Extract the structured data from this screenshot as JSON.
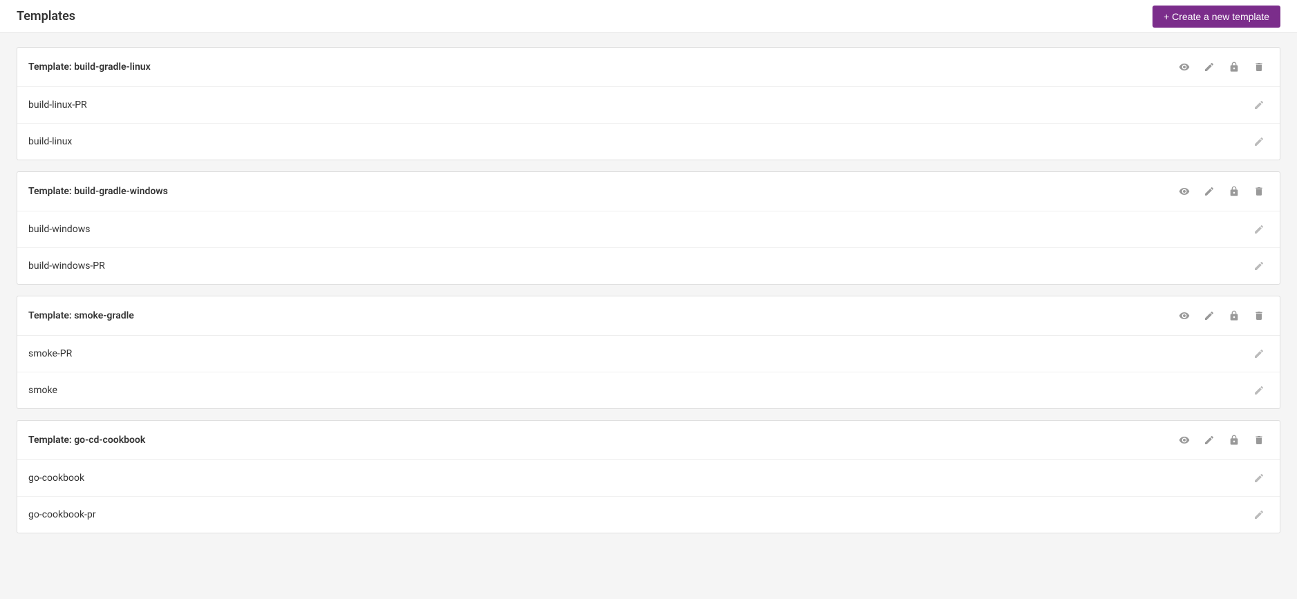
{
  "header": {
    "title": "Templates",
    "create_button_label": "+ Create a new template"
  },
  "templates": [
    {
      "id": "build-gradle-linux",
      "title": "Template: build-gradle-linux",
      "pipelines": [
        {
          "name": "build-linux-PR"
        },
        {
          "name": "build-linux"
        }
      ]
    },
    {
      "id": "build-gradle-windows",
      "title": "Template: build-gradle-windows",
      "pipelines": [
        {
          "name": "build-windows"
        },
        {
          "name": "build-windows-PR"
        }
      ]
    },
    {
      "id": "smoke-gradle",
      "title": "Template: smoke-gradle",
      "pipelines": [
        {
          "name": "smoke-PR"
        },
        {
          "name": "smoke"
        }
      ]
    },
    {
      "id": "go-cd-cookbook",
      "title": "Template: go-cd-cookbook",
      "pipelines": [
        {
          "name": "go-cookbook"
        },
        {
          "name": "go-cookbook-pr"
        }
      ]
    }
  ],
  "icons": {
    "eye": "eye-icon",
    "edit": "edit-icon",
    "lock": "lock-icon",
    "trash": "trash-icon",
    "plus": "plus-icon"
  },
  "colors": {
    "primary": "#7b2d8b",
    "icon_default": "#aaa",
    "icon_hover": "#555"
  }
}
